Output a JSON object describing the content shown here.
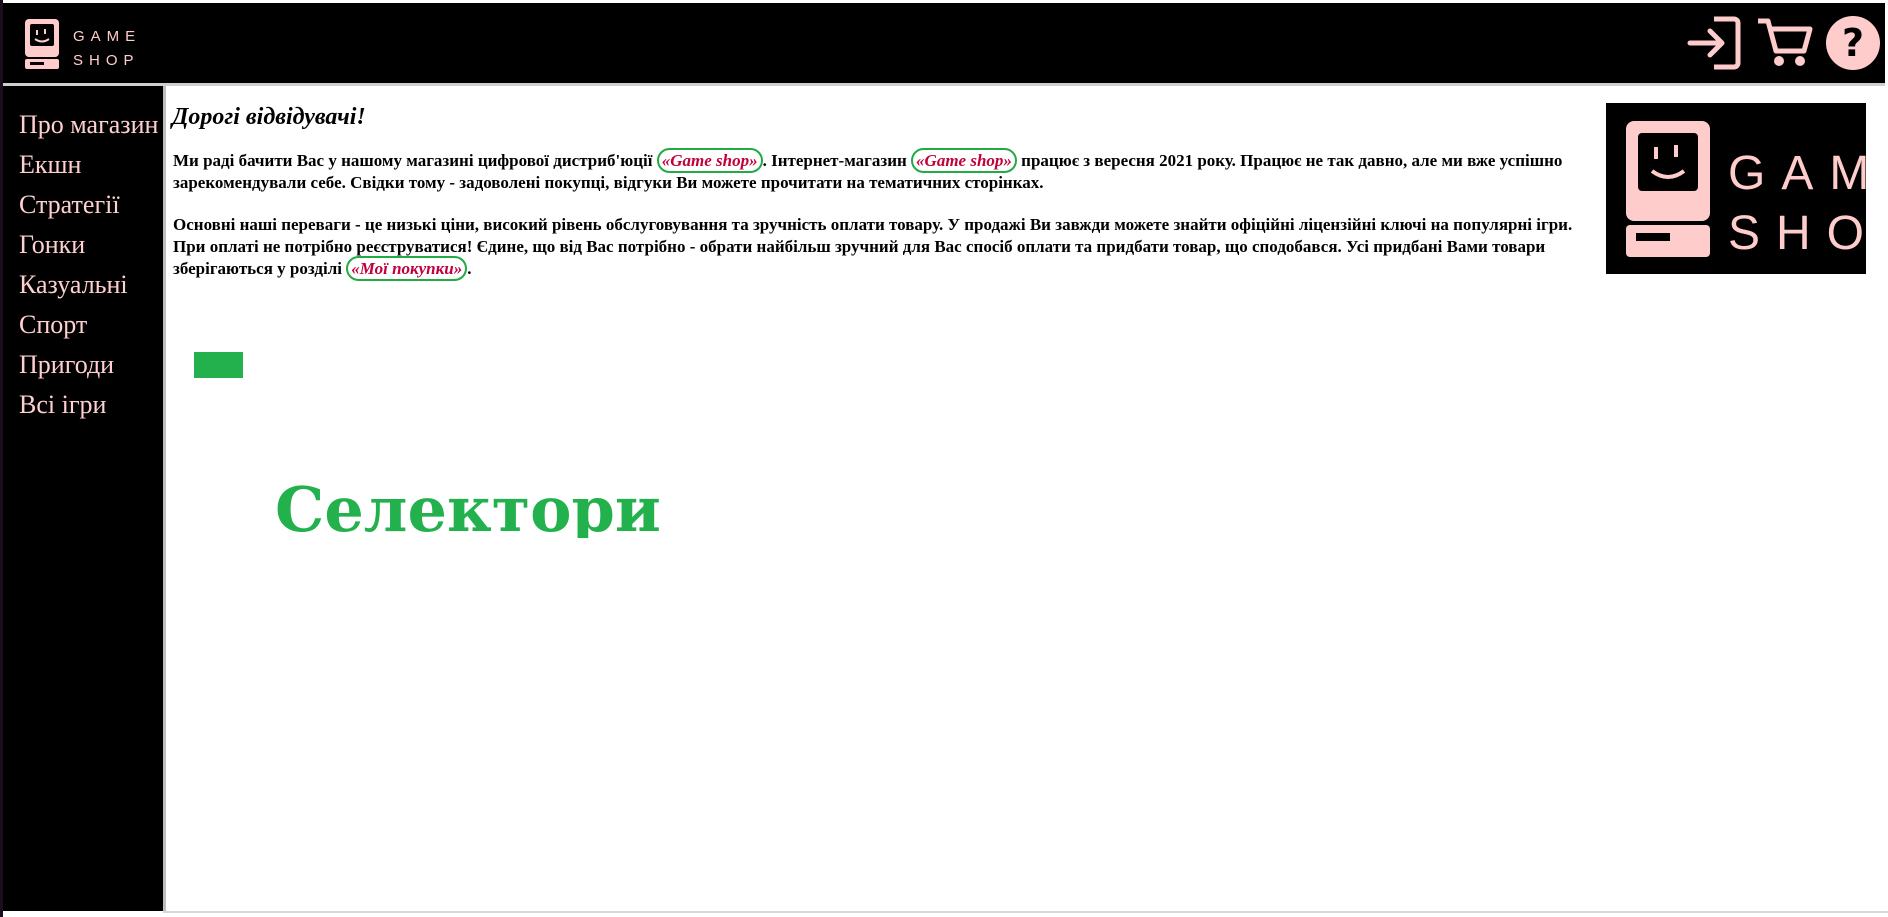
{
  "header": {
    "logo_text_line1": "GAME",
    "logo_text_line2": "SHOP",
    "icons": [
      "login-icon",
      "cart-icon",
      "help-icon"
    ]
  },
  "sidebar": {
    "items": [
      {
        "label": "Про магазин"
      },
      {
        "label": "Екшн"
      },
      {
        "label": "Стратегії"
      },
      {
        "label": "Гонки"
      },
      {
        "label": "Казуальні"
      },
      {
        "label": "Спорт"
      },
      {
        "label": "Пригоди"
      },
      {
        "label": "Всі ігри"
      }
    ]
  },
  "main": {
    "greeting": "Дорогі відвідувачі!",
    "para1": {
      "part1": "Ми раді бачити Вас у нашому магазині цифрової дистриб'юції ",
      "link1": "«Game shop»",
      "part2": ". Інтернет-магазин ",
      "link2": "«Game shop»",
      "part3": " працює з вересня 2021 року. Працює не так давно, але ми вже успішно зарекомендували себе. Свідки тому - задоволені покупці, відгуки Ви можете прочитати на тематичних сторінках."
    },
    "para2": {
      "part1": "Основні наші переваги - це низькі ціни, високий рівень обслуговування та зручність оплати товару. У продажі Ви завжди можете знайти офіційні ліцензійні ключі на популярні ігри. При оплаті не потрібно реєструватися! Єдине, що від Вас потрібно - обрати найбільш зручний для Вас спосіб оплати та придбати товар, що сподобався. Усі придбані Вами товари зберігаються у розділі ",
      "link": "«Мої покупки»",
      "part2": "."
    },
    "big_logo_line1": "GAME",
    "big_logo_line2": "SHOP",
    "heading": "Селектори"
  },
  "colors": {
    "accent_pink": "#ffd0d0",
    "link_red": "#c2003a",
    "green": "#22b14c",
    "background_dark": "#000000"
  }
}
